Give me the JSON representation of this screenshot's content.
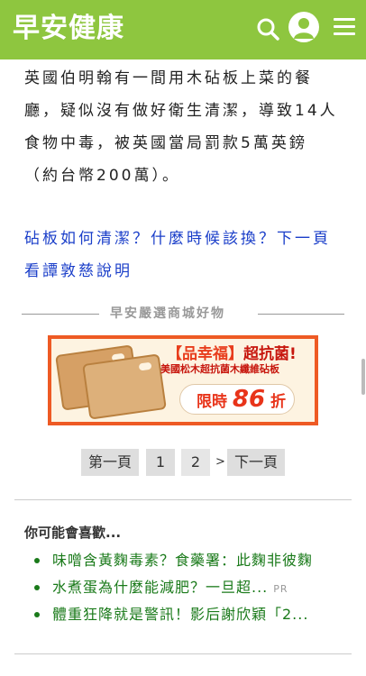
{
  "header": {
    "logo_text": "早安健康",
    "search_icon": "search-icon",
    "avatar_icon": "user-icon",
    "menu_icon": "menu-icon",
    "brand_color": "#8ec63f"
  },
  "article": {
    "paragraph": "英國伯明翰有一間用木砧板上菜的餐廳，疑似沒有做好衛生清潔，導致14人食物中毒，被英國當局罰款5萬英鎊（約台幣200萬）。",
    "link_text": "砧板如何清潔？什麼時候該換？下一頁看譚敦慈說明"
  },
  "shop_section": {
    "title": "早安嚴選商城好物",
    "banner": {
      "title_prefix": "【品幸福】",
      "title_highlight": "超抗菌!",
      "subtitle": "美國松木超抗菌木纖維砧板",
      "price_prefix": "限時",
      "price_number": "86",
      "price_suffix": "折"
    }
  },
  "pagination": {
    "first": "第一頁",
    "page1": "1",
    "page2": "2",
    "separator": ">",
    "next": "下一頁"
  },
  "recommend": {
    "title": "你可能會喜歡...",
    "items": [
      {
        "text": "味噌含黃麴毒素？食藥署：此麴非彼麴",
        "pr": ""
      },
      {
        "text": "水煮蛋為什麼能減肥？一旦超...",
        "pr": "PR"
      },
      {
        "text": "體重狂降就是警訊！影后謝欣穎「2...",
        "pr": ""
      }
    ]
  }
}
